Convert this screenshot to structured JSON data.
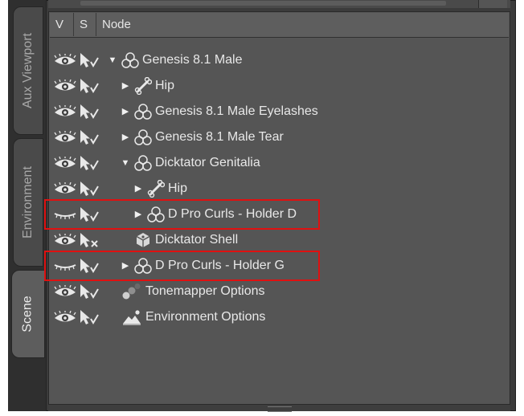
{
  "tabs": [
    {
      "label": "Aux Viewport",
      "active": false
    },
    {
      "label": "Environment",
      "active": false
    },
    {
      "label": "Scene",
      "active": true
    }
  ],
  "header": {
    "v": "V",
    "s": "S",
    "node": "Node"
  },
  "rows": [
    {
      "label": "Genesis 8.1 Male",
      "visibility": "eye-open",
      "select": "select-check",
      "arrow": "down",
      "icon": "figure-icon",
      "depth": 0
    },
    {
      "label": "Hip",
      "visibility": "eye-open",
      "select": "select-check",
      "arrow": "right",
      "icon": "bone-icon",
      "depth": 1
    },
    {
      "label": "Genesis 8.1 Male Eyelashes",
      "visibility": "eye-open",
      "select": "select-check",
      "arrow": "right",
      "icon": "figure-icon",
      "depth": 1
    },
    {
      "label": "Genesis 8.1 Male Tear",
      "visibility": "eye-open",
      "select": "select-check",
      "arrow": "right",
      "icon": "figure-icon",
      "depth": 1
    },
    {
      "label": "Dicktator Genitalia",
      "visibility": "eye-open",
      "select": "select-check",
      "arrow": "down",
      "icon": "figure-icon",
      "depth": 1
    },
    {
      "label": "Hip",
      "visibility": "eye-open",
      "select": "select-check",
      "arrow": "right",
      "icon": "bone-icon",
      "depth": 2
    },
    {
      "label": "D Pro Curls - Holder D",
      "visibility": "eye-closed",
      "select": "select-check",
      "arrow": "right",
      "icon": "figure-icon",
      "depth": 2,
      "highlighted": true
    },
    {
      "label": "Dicktator Shell",
      "visibility": "eye-open",
      "select": "select-x",
      "arrow": "none",
      "icon": "shell-icon",
      "depth": 1
    },
    {
      "label": "D Pro Curls - Holder G",
      "visibility": "eye-closed",
      "select": "select-check",
      "arrow": "right",
      "icon": "figure-icon",
      "depth": 1,
      "highlighted": true
    },
    {
      "label": "Tonemapper Options",
      "visibility": "eye-open",
      "select": "select-check",
      "arrow": "none",
      "icon": "tonemapper-icon",
      "depth": 0
    },
    {
      "label": "Environment Options",
      "visibility": "eye-open",
      "select": "select-check",
      "arrow": "none",
      "icon": "environment-icon",
      "depth": 0
    }
  ],
  "colors": {
    "highlight": "#e01010",
    "panel": "#555555",
    "text": "#e8e8e8"
  }
}
